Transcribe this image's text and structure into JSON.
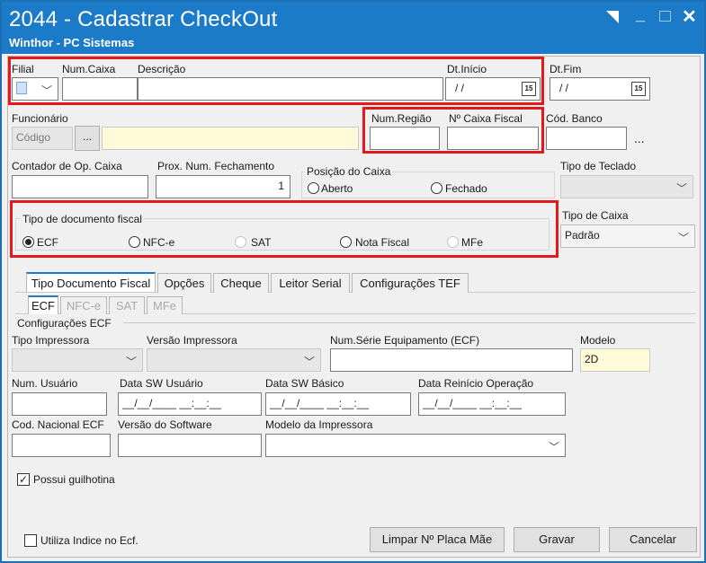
{
  "window": {
    "title": "2044 - Cadastrar CheckOut",
    "subtitle": "Winthor - PC Sistemas"
  },
  "top_row": {
    "filial_label": "Filial",
    "num_caixa_label": "Num.Caixa",
    "descricao_label": "Descrição",
    "dt_inicio_label": "Dt.Início",
    "dt_inicio_value": "/ /",
    "dt_fim_label": "Dt.Fim",
    "dt_fim_value": "/ /",
    "cal_glyph": "15"
  },
  "row2": {
    "funcionario_label": "Funcionário",
    "codigo_placeholder": "Código",
    "ellipsis": "...",
    "num_regiao_label": "Num.Região",
    "num_caixa_fiscal_label": "Nº Caixa Fiscal",
    "cod_banco_label": "Cód. Banco",
    "cod_banco_ellipsis": "..."
  },
  "row3": {
    "contador_label": "Contador de Op. Caixa",
    "prox_num_label": "Prox. Num. Fechamento",
    "prox_num_value": "1",
    "posicao_label": "Posição do Caixa",
    "aberto_label": "Aberto",
    "fechado_label": "Fechado",
    "tipo_teclado_label": "Tipo de Teclado"
  },
  "tipo_doc": {
    "label": "Tipo de documento fiscal",
    "options": [
      "ECF",
      "NFC-e",
      "SAT",
      "Nota Fiscal",
      "MFe"
    ],
    "selected": "ECF"
  },
  "tipo_caixa": {
    "label": "Tipo de Caixa",
    "value": "Padrão"
  },
  "tabs": [
    "Tipo Documento Fiscal",
    "Opções",
    "Cheque",
    "Leitor Serial",
    "Configurações TEF"
  ],
  "subtabs": [
    "ECF",
    "NFC-e",
    "SAT",
    "MFe"
  ],
  "ecf": {
    "group_label": "Configurações ECF",
    "tipo_impressora_label": "Tipo Impressora",
    "versao_impressora_label": "Versão Impressora",
    "num_serie_label": "Num.Série Equipamento (ECF)",
    "modelo_label": "Modelo",
    "modelo_value": "2D",
    "num_usuario_label": "Num. Usuário",
    "data_sw_usuario_label": "Data  SW Usuário",
    "data_sw_usuario_value": "__/__/____ __:__:__",
    "data_sw_basico_label": "Data SW Básico",
    "data_sw_basico_value": "__/__/____ __:__:__",
    "data_reinicio_label": "Data Reinício Operação",
    "data_reinicio_value": "__/__/____ __:__:__",
    "cod_nacional_label": "Cod. Nacional ECF",
    "versao_software_label": "Versão do Software",
    "modelo_impressora_label": "Modelo da Impressora",
    "guilhotina_label": "Possui guilhotina",
    "guilhotina_checked": true
  },
  "footer": {
    "utiliza_indice_label": "Utiliza Indice no Ecf.",
    "limpar_label": "Limpar Nº Placa Mãe",
    "gravar_label": "Gravar",
    "cancelar_label": "Cancelar"
  },
  "colors": {
    "titlebar": "#1c7bc8",
    "highlight": "#e3191c",
    "yellow_field": "#fffbd9"
  }
}
